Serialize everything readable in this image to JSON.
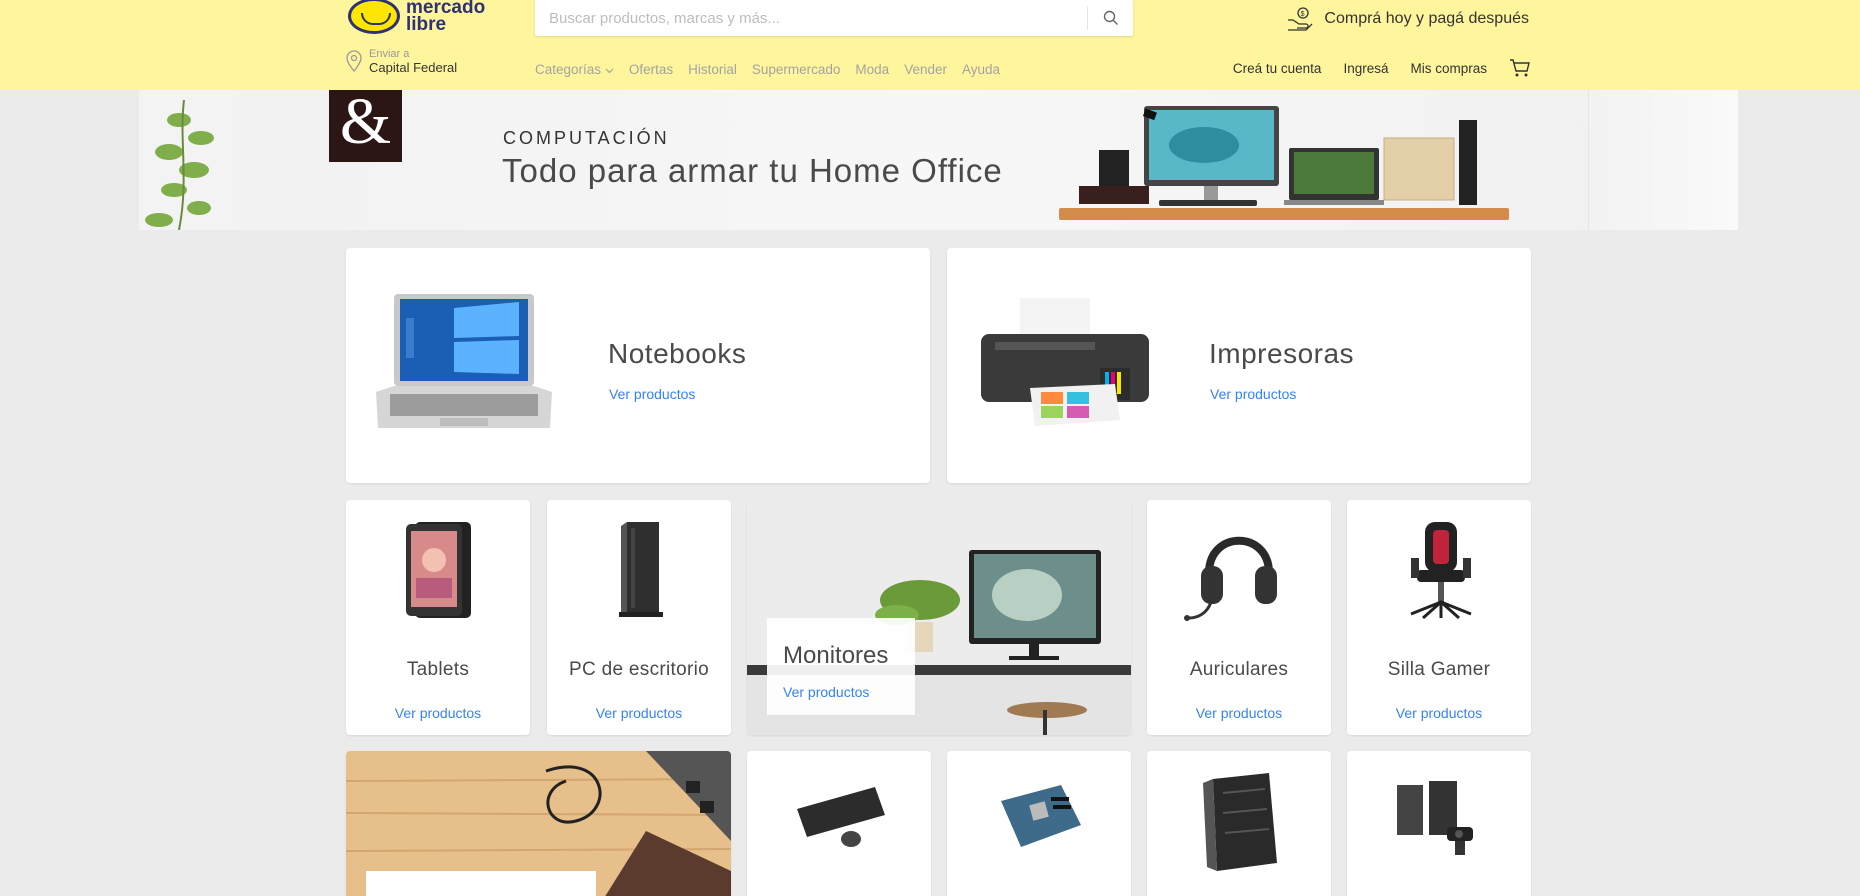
{
  "header": {
    "logo_text_line1": "mercado",
    "logo_text_line2": "libre",
    "search_placeholder": "Buscar productos, marcas y más...",
    "promo_text": "Comprá hoy y pagá después",
    "location_label": "Enviar a",
    "location_value": "Capital Federal",
    "nav": [
      "Categorías",
      "Ofertas",
      "Historial",
      "Supermercado",
      "Moda",
      "Vender",
      "Ayuda"
    ],
    "user_nav": [
      "Creá tu cuenta",
      "Ingresá",
      "Mis compras"
    ]
  },
  "banner": {
    "category": "COMPUTACIÓN",
    "title": "Todo para armar tu Home Office",
    "logo_glyph": "&"
  },
  "cards": {
    "link_label": "Ver productos",
    "notebooks": "Notebooks",
    "impresoras": "Impresoras",
    "tablets": "Tablets",
    "pc": "PC de escritorio",
    "monitores": "Monitores",
    "auriculares": "Auriculares",
    "silla": "Silla Gamer"
  },
  "colors": {
    "header_bg": "#fff59d",
    "link": "#3483fa",
    "page_bg": "#ebebeb"
  }
}
